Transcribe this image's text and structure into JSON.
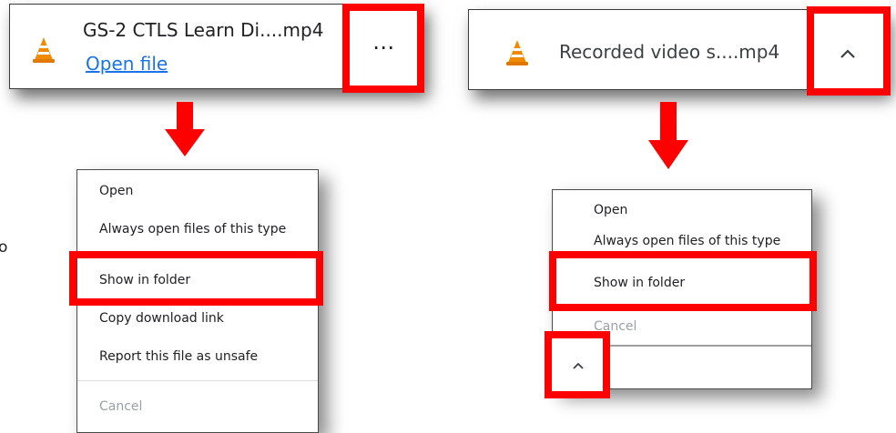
{
  "left_item": {
    "file_name": "GS-2 CTLS Learn Di....mp4",
    "open_file_link": "Open file",
    "more_glyph": "⋯"
  },
  "right_item": {
    "file_name": "Recorded video s....mp4",
    "chevron_glyph": "^"
  },
  "left_menu": {
    "items": [
      "Open",
      "Always open files of this type",
      "Show in folder",
      "Copy download link",
      "Report this file as unsafe"
    ],
    "cancel": "Cancel"
  },
  "right_menu": {
    "items": [
      "Open",
      "Always open files of this type",
      "Show in folder"
    ],
    "cancel": "Cancel",
    "chevron_glyph": "^"
  },
  "edge_text": "o",
  "colors": {
    "highlight": "#ff0000",
    "link": "#1a73e8",
    "vlc_orange": "#f08a00",
    "disabled_text": "#9aa0a6"
  }
}
